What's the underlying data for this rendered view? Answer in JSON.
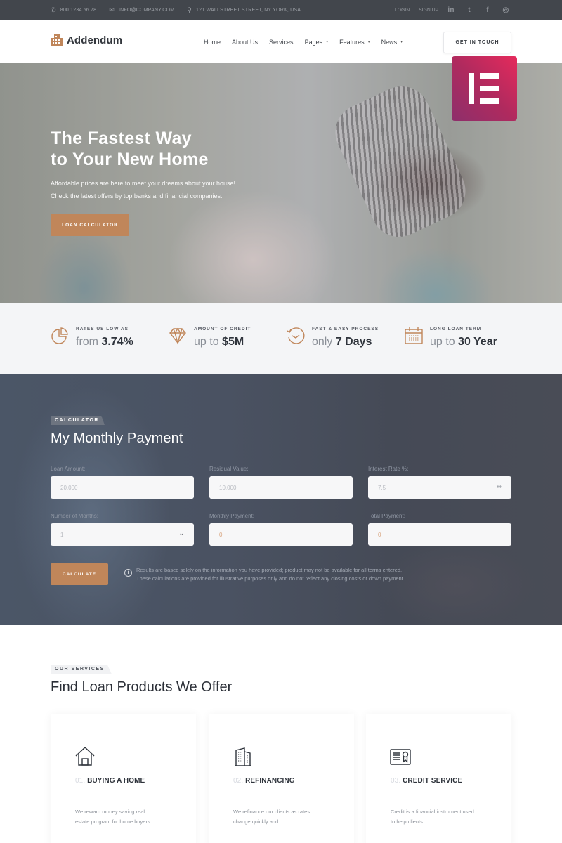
{
  "topbar": {
    "phone": "800 1234 56 78",
    "email": "INFO@COMPANY.COM",
    "address": "121 WALLSTREET STREET, NY YORK, USA",
    "login": "LOGIN",
    "signup": "SIGN UP",
    "social": [
      {
        "icon": "linkedin-icon",
        "glyph": "in"
      },
      {
        "icon": "twitter-icon",
        "glyph": "t"
      },
      {
        "icon": "facebook-icon",
        "glyph": "f"
      },
      {
        "icon": "instagram-icon",
        "glyph": "◎"
      }
    ]
  },
  "nav": {
    "brand": "Addendum",
    "items": [
      {
        "label": "Home",
        "dropdown": false
      },
      {
        "label": "About Us",
        "dropdown": false
      },
      {
        "label": "Services",
        "dropdown": false
      },
      {
        "label": "Pages",
        "dropdown": true
      },
      {
        "label": "Features",
        "dropdown": true
      },
      {
        "label": "News",
        "dropdown": true
      }
    ],
    "caret": "▾",
    "cta": "GET IN TOUCH"
  },
  "hero": {
    "title_line1": "The Fastest Way",
    "title_line2": "to Your New Home",
    "sub_line1": "Affordable prices are here to meet your dreams about your house!",
    "sub_line2": "Check the latest offers by top banks and financial companies.",
    "button": "LOAN CALCULATOR"
  },
  "stats": [
    {
      "icon": "pie-chart-icon",
      "label": "RATES US LOW AS",
      "prefix": "from",
      "value": "3.74%"
    },
    {
      "icon": "diamond-icon",
      "label": "AMOUNT OF CREDIT",
      "prefix": "up to",
      "value": "$5M"
    },
    {
      "icon": "clock-refresh-icon",
      "label": "FAST & EASY PROCESS",
      "prefix": "only",
      "value": "7 Days"
    },
    {
      "icon": "calendar-icon",
      "label": "LONG LOAN TERM",
      "prefix": "up to",
      "value": "30 Year"
    }
  ],
  "calculator": {
    "tag": "CALCULATOR",
    "title": "My Monthly Payment",
    "fields": {
      "loan_amount": {
        "label": "Loan Amount:",
        "value": "20,000"
      },
      "residual_value": {
        "label": "Residual Value:",
        "value": "10,000"
      },
      "interest_rate": {
        "label": "Interest Rate %:",
        "value": "7.5"
      },
      "months": {
        "label": "Number of Months:",
        "value": "1"
      },
      "monthly_payment": {
        "label": "Monthly Payment:",
        "value": "0"
      },
      "total_payment": {
        "label": "Total Payment:",
        "value": "0"
      }
    },
    "button": "CALCULATE",
    "note_line1": "Results are based solely on the information you have provided; product may not be available for all terms entered.",
    "note_line2": "These calculations are provided for illustrative purposes only and do not reflect any closing costs or down payment.",
    "info_glyph": "i"
  },
  "services": {
    "tag": "OUR SERVICES",
    "title": "Find Loan Products We Offer",
    "cards": [
      {
        "icon": "house-icon",
        "num": "01.",
        "title": "BUYING A HOME",
        "desc_line1": "We reward money saving real",
        "desc_line2": "estate program for home buyers..."
      },
      {
        "icon": "building-icon",
        "num": "02.",
        "title": "REFINANCING",
        "desc_line1": "We refinance our clients as rates",
        "desc_line2": "change quickly and..."
      },
      {
        "icon": "certificate-icon",
        "num": "03.",
        "title": "CREDIT SERVICE",
        "desc_line1": "Credit is a financial instrument used",
        "desc_line2": "to help clients..."
      }
    ]
  },
  "colors": {
    "accent": "#c0865a",
    "topbar_bg": "#42464c",
    "stats_bg": "#f4f5f7",
    "elementor_gradient_start": "#8d2f6b",
    "elementor_gradient_end": "#e52a5c"
  }
}
